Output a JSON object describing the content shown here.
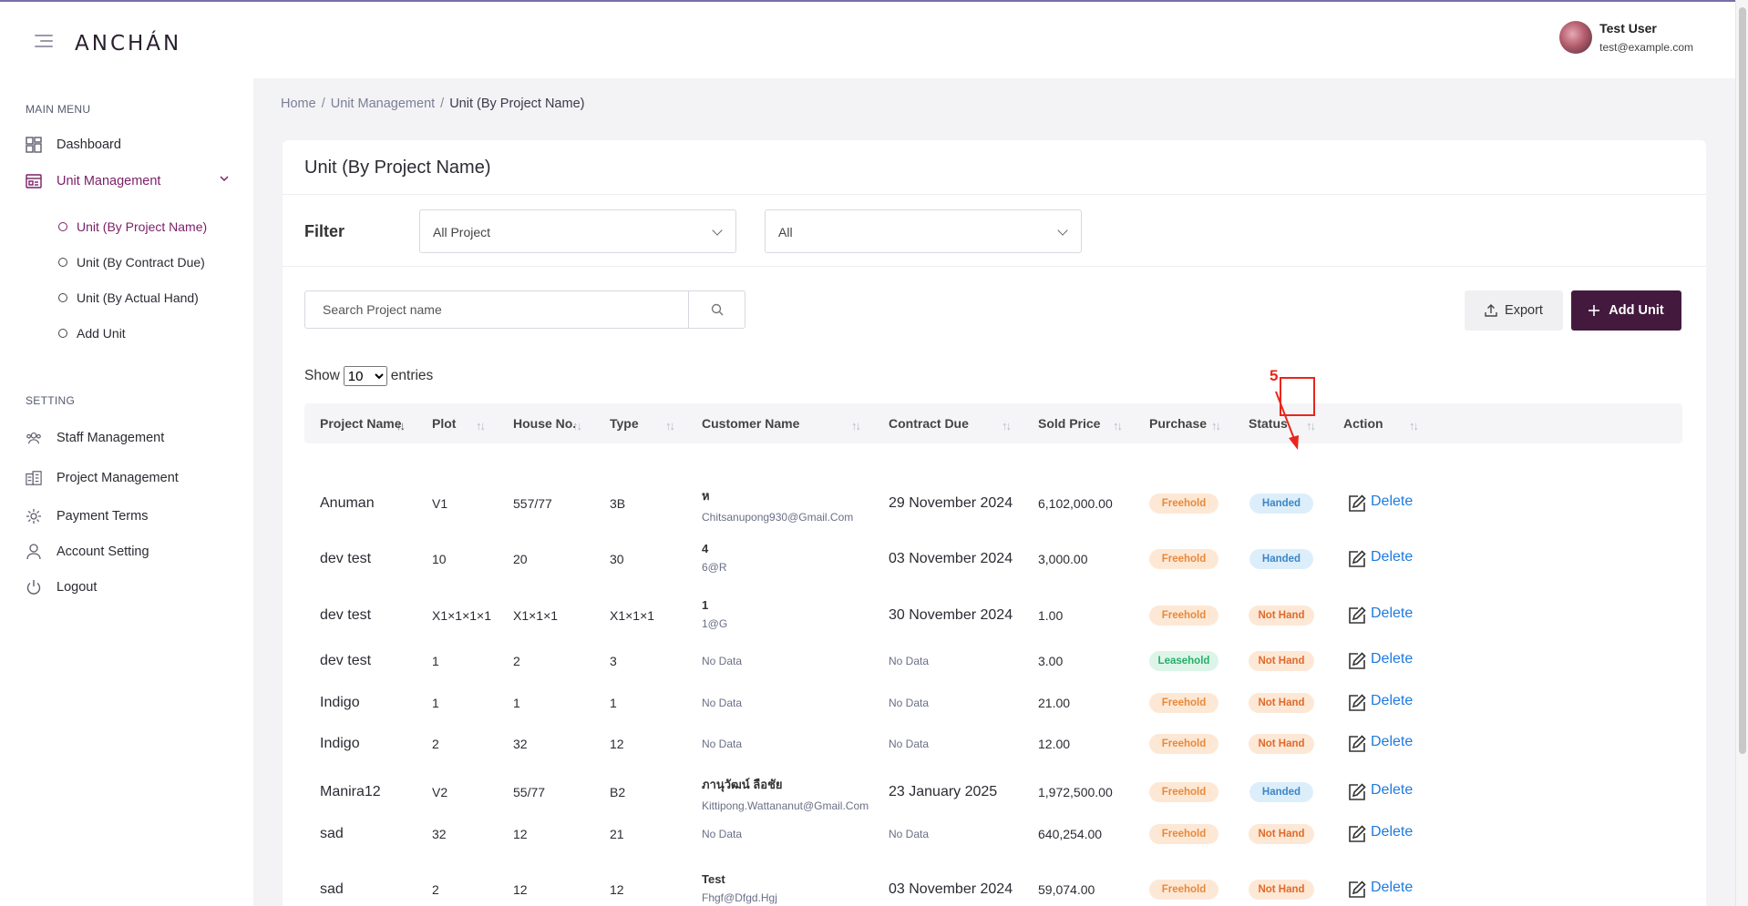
{
  "header": {
    "logo": "ANCHÁN",
    "user_name": "Test User",
    "user_email": "test@example.com"
  },
  "sidebar": {
    "main_menu_label": "MAIN MENU",
    "dashboard": "Dashboard",
    "unit_management": "Unit Management",
    "sub_items": [
      "Unit (By Project Name)",
      "Unit (By Contract Due)",
      "Unit (By Actual Hand)",
      "Add Unit"
    ],
    "setting_label": "SETTING",
    "settings": [
      "Staff Management",
      "Project Management",
      "Payment Terms",
      "Account Setting",
      "Logout"
    ]
  },
  "breadcrumb": [
    "Home",
    "Unit Management",
    "Unit (By Project Name)"
  ],
  "page": {
    "title": "Unit (By Project Name)",
    "filter_label": "Filter",
    "filter_project": "All Project",
    "filter_status": "All",
    "search_placeholder": "Search Project name",
    "export_label": "Export",
    "add_label": "Add Unit",
    "show_label": "Show",
    "entries_value": "10",
    "entries_label": "entries"
  },
  "annotation": {
    "step": "5"
  },
  "table": {
    "headers": [
      "Project Name",
      "Plot",
      "House No.",
      "Type",
      "Customer Name",
      "Contract Due",
      "Sold Price",
      "Purchase",
      "Status",
      "Action"
    ],
    "delete_label": "Delete",
    "no_data": "No Data",
    "rows": [
      {
        "project": "Anuman",
        "plot": "V1",
        "house": "557/77",
        "type": "3B",
        "cust_name": "ห",
        "cust_email": "Chitsanupong930@Gmail.Com",
        "due": "29 November 2024",
        "price": "6,102,000.00",
        "purchase": "Freehold",
        "status": "Handed"
      },
      {
        "project": "dev test",
        "plot": "10",
        "house": "20",
        "type": "30",
        "cust_name": "4",
        "cust_email": "6@R",
        "due": "03 November 2024",
        "price": "3,000.00",
        "purchase": "Freehold",
        "status": "Handed"
      },
      {
        "project": "dev test",
        "plot": "X1×1×1×1",
        "house": "X1×1×1",
        "type": "X1×1×1",
        "cust_name": "1",
        "cust_email": "1@G",
        "due": "30 November 2024",
        "price": "1.00",
        "purchase": "Freehold",
        "status": "Not Hand"
      },
      {
        "project": "dev test",
        "plot": "1",
        "house": "2",
        "type": "3",
        "cust_name": "",
        "cust_email": "",
        "due": "",
        "price": "3.00",
        "purchase": "Leasehold",
        "status": "Not Hand"
      },
      {
        "project": "Indigo",
        "plot": "1",
        "house": "1",
        "type": "1",
        "cust_name": "",
        "cust_email": "",
        "due": "",
        "price": "21.00",
        "purchase": "Freehold",
        "status": "Not Hand"
      },
      {
        "project": "Indigo",
        "plot": "2",
        "house": "32",
        "type": "12",
        "cust_name": "",
        "cust_email": "",
        "due": "",
        "price": "12.00",
        "purchase": "Freehold",
        "status": "Not Hand"
      },
      {
        "project": "Manira12",
        "plot": "V2",
        "house": "55/77",
        "type": "B2",
        "cust_name": "ภานุวัฒน์ ลือชัย",
        "cust_email": "Kittipong.Wattananut@Gmail.Com",
        "due": "23 January 2025",
        "price": "1,972,500.00",
        "purchase": "Freehold",
        "status": "Handed"
      },
      {
        "project": "sad",
        "plot": "32",
        "house": "12",
        "type": "21",
        "cust_name": "",
        "cust_email": "",
        "due": "",
        "price": "640,254.00",
        "purchase": "Freehold",
        "status": "Not Hand"
      },
      {
        "project": "sad",
        "plot": "2",
        "house": "12",
        "type": "12",
        "cust_name": "Test",
        "cust_email": "Fhgf@Dfgd.Hgj",
        "due": "03 November 2024",
        "price": "59,074.00",
        "purchase": "Freehold",
        "status": "Not Hand"
      }
    ]
  }
}
